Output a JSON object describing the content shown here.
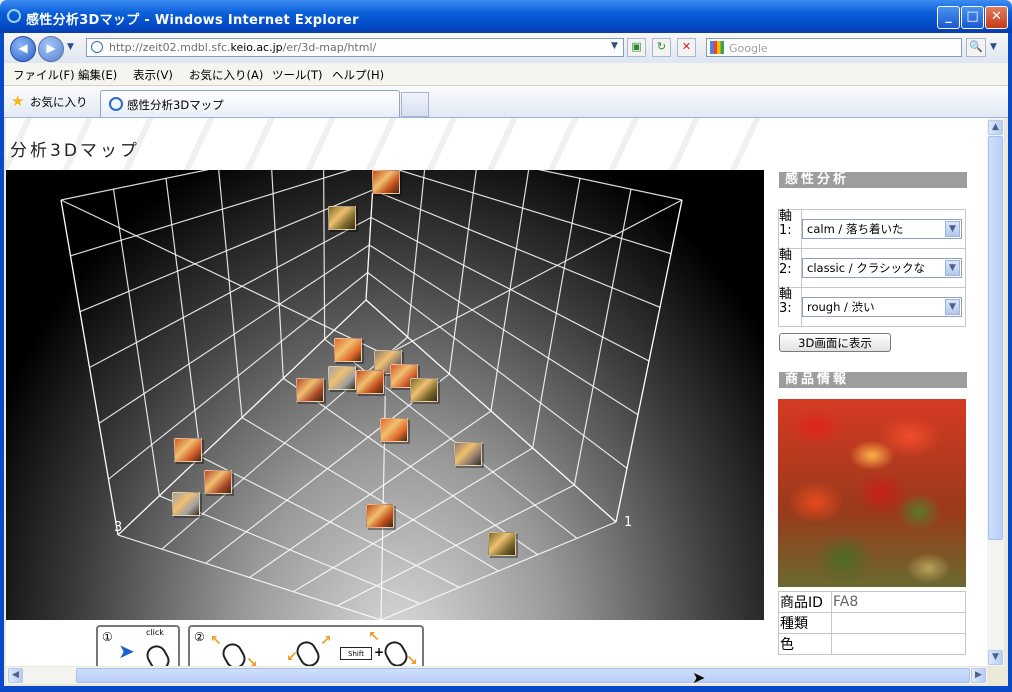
{
  "window": {
    "title": "感性分析3Dマップ - Windows Internet Explorer",
    "minimize": "_",
    "maximize": "□",
    "close": "✕"
  },
  "navbar": {
    "back": "◀",
    "forward": "▶",
    "address_prefix": "http://zeit02.mdbl.sfc.",
    "address_domain": "keio.ac.jp",
    "address_suffix": "/er/3d-map/html/",
    "search_placeholder": "Google",
    "search_go": "🔍"
  },
  "menu": [
    "ファイル(F)",
    "編集(E)",
    "表示(V)",
    "お気に入り(A)",
    "ツール(T)",
    "ヘルプ(H)"
  ],
  "favbar": {
    "favorites_label": "お気に入り",
    "tab_label": "感性分析3Dマップ"
  },
  "page": {
    "title": "分析3Dマップ",
    "axis_label_left": "3",
    "axis_label_right": "1",
    "analysis_heading": "感性分析",
    "axes": [
      {
        "label": "軸1:",
        "value": "calm / 落ち着いた"
      },
      {
        "label": "軸2:",
        "value": "classic / クラシックな"
      },
      {
        "label": "軸3:",
        "value": "rough / 渋い"
      }
    ],
    "show_button": "3D画面に表示",
    "product_heading": "商品情報",
    "product_info": [
      {
        "key": "商品ID",
        "value": "FA8"
      },
      {
        "key": "種類",
        "value": ""
      },
      {
        "key": "色",
        "value": ""
      }
    ],
    "instructions": {
      "step1_number": "①",
      "step1_click": "click",
      "step2_number": "②",
      "shift_key": "Shift"
    }
  },
  "colors": {
    "titlebar": "#0a5fd8",
    "panel_heading_bg": "#9d9d9d",
    "cube_colors": [
      "#c24c1a",
      "#7a6a2a",
      "#e06a2a",
      "#8a7a6a",
      "#d2582a",
      "#b04a2a",
      "#a0a0a0"
    ]
  }
}
